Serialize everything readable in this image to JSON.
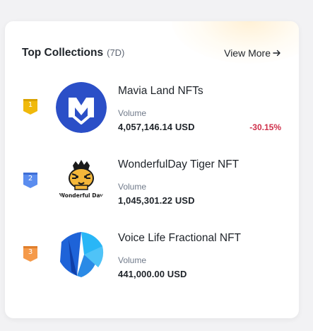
{
  "header": {
    "title": "Top Collections",
    "period": "(7D)",
    "view_more": "View More"
  },
  "collections": [
    {
      "rank": "1",
      "name": "Mavia Land NFTs",
      "volume_label": "Volume",
      "volume": "4,057,146.14 USD",
      "change": "-30.15%",
      "logo_icon": "mavia-logo-icon"
    },
    {
      "rank": "2",
      "name": "WonderfulDay Tiger NFT",
      "volume_label": "Volume",
      "volume": "1,045,301.22 USD",
      "change": "",
      "logo_icon": "tiger-logo-icon",
      "logo_text": "Wonderful Day"
    },
    {
      "rank": "3",
      "name": "Voice Life Fractional NFT",
      "volume_label": "Volume",
      "volume": "441,000.00 USD",
      "change": "",
      "logo_icon": "voice-life-logo-icon"
    }
  ],
  "colors": {
    "rank_gold": "#f0b90b",
    "rank_silver": "#5b8def",
    "rank_bronze": "#f59a4a",
    "negative": "#cf304a",
    "mavia_blue": "#2b4fc7"
  }
}
